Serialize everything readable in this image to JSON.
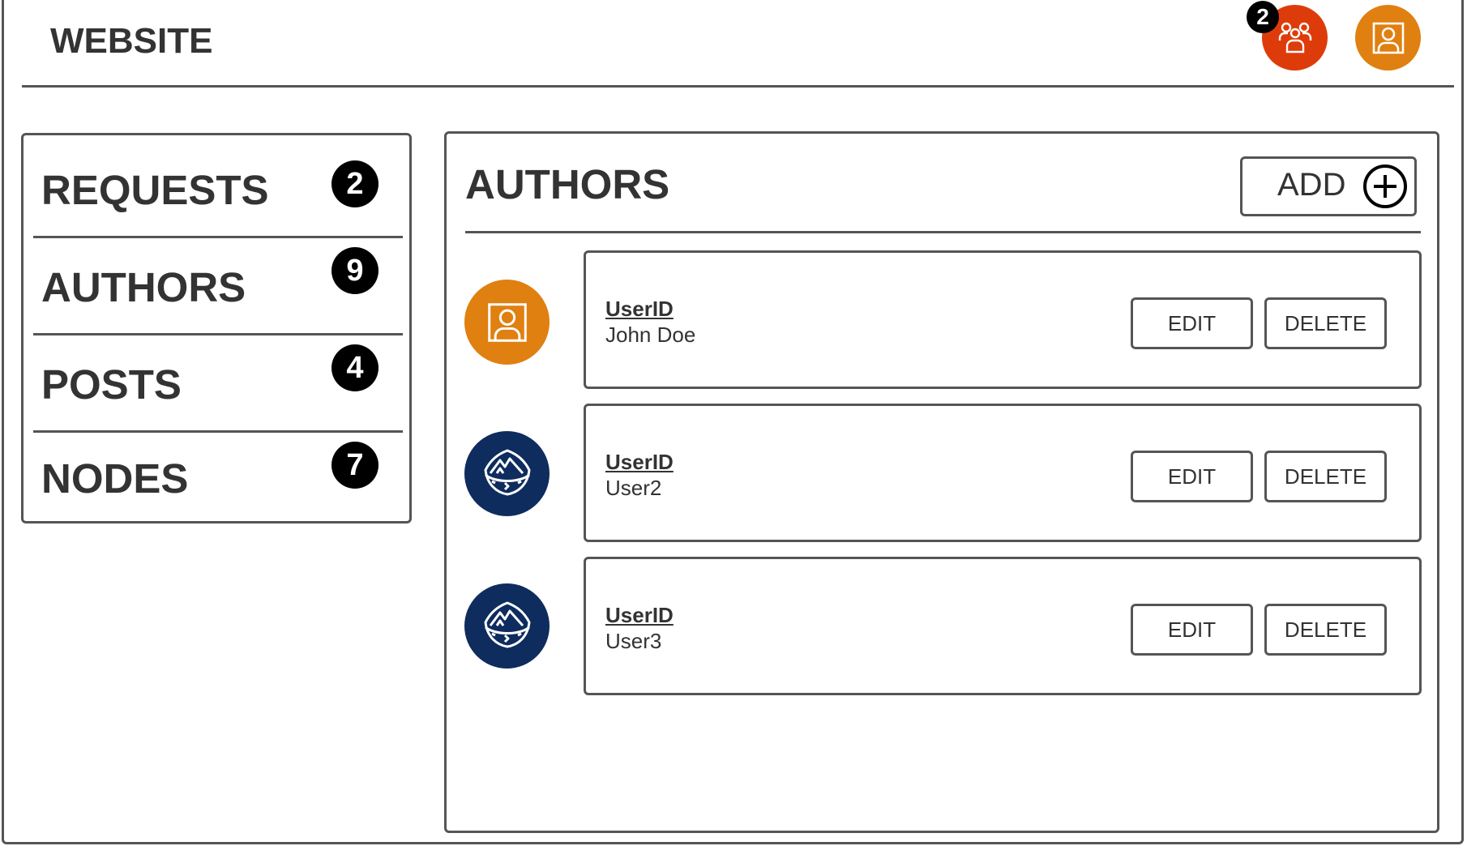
{
  "header": {
    "title": "WEBSITE",
    "notifications": {
      "icon": "group-icon",
      "count": "2",
      "color": "#dd3c0a"
    },
    "profile": {
      "icon": "user-portrait-icon",
      "color": "#e08010"
    }
  },
  "sidebar": {
    "items": [
      {
        "label": "REQUESTS",
        "count": "2"
      },
      {
        "label": "AUTHORS",
        "count": "9"
      },
      {
        "label": "POSTS",
        "count": "4"
      },
      {
        "label": "NODES",
        "count": "7"
      }
    ]
  },
  "main": {
    "title": "AUTHORS",
    "add_label": "ADD",
    "add_icon": "plus-circle-icon",
    "authors": [
      {
        "id_label": "UserID",
        "name": "John Doe",
        "avatar_icon": "user-portrait-icon",
        "avatar_color": "#e08010",
        "edit_label": "EDIT",
        "delete_label": "DELETE"
      },
      {
        "id_label": "UserID",
        "name": "User2",
        "avatar_icon": "mountain-shield-icon",
        "avatar_color": "#0e2c5e",
        "edit_label": "EDIT",
        "delete_label": "DELETE"
      },
      {
        "id_label": "UserID",
        "name": "User3",
        "avatar_icon": "mountain-shield-icon",
        "avatar_color": "#0e2c5e",
        "edit_label": "EDIT",
        "delete_label": "DELETE"
      }
    ]
  }
}
